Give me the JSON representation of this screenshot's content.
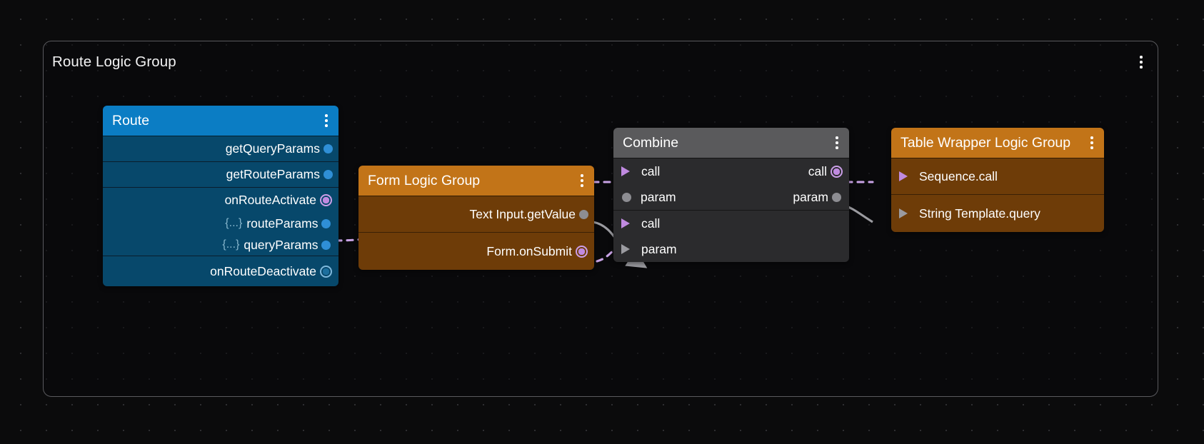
{
  "canvas": {
    "background_color": "#0b0b0c",
    "dot_grid_color": "#2e2e31"
  },
  "group_frame": {
    "title": "Route Logic Group",
    "menu_icon": "kebab-menu-icon",
    "border_color": "#5a5a5e"
  },
  "nodes": [
    {
      "id": "route",
      "title": "Route",
      "palette": "blue",
      "header_color": "#0b7dc4",
      "body_color": "#07486b",
      "menu_icon": "kebab-menu-icon",
      "sections": [
        {
          "rows": [
            {
              "label": "getQueryParams",
              "port": "dot-blue",
              "align": "right"
            }
          ]
        },
        {
          "rows": [
            {
              "label": "getRouteParams",
              "port": "dot-blue",
              "align": "right"
            }
          ]
        },
        {
          "rows": [
            {
              "label": "onRouteActivate",
              "port": "ring-purple",
              "align": "right"
            },
            {
              "prefix": "{...}",
              "label": "routeParams",
              "port": "dot-blue",
              "align": "right"
            },
            {
              "prefix": "{...}",
              "label": "queryParams",
              "port": "dot-blue",
              "align": "right"
            }
          ]
        },
        {
          "rows": [
            {
              "label": "onRouteDeactivate",
              "port": "ring-blue",
              "align": "right"
            }
          ]
        }
      ]
    },
    {
      "id": "form",
      "title": "Form Logic Group",
      "palette": "orange",
      "header_color": "#c27418",
      "body_color": "#6e3c08",
      "menu_icon": "kebab-menu-icon",
      "sections": [
        {
          "rows": [
            {
              "label": "Text Input.getValue",
              "port": "dot-gray",
              "align": "right"
            }
          ]
        },
        {
          "rows": [
            {
              "label": "Form.onSubmit",
              "port": "ring-purple",
              "align": "right"
            }
          ]
        }
      ]
    },
    {
      "id": "combine",
      "title": "Combine",
      "palette": "gray",
      "header_color": "#5a5a5c",
      "body_color": "#2b2b2d",
      "menu_icon": "kebab-menu-icon",
      "sections": [
        {
          "rows": [
            {
              "label": "call",
              "port": "tri-purple",
              "align": "left",
              "out_label": "call",
              "out_port": "ring-purple"
            },
            {
              "label": "param",
              "port": "dot-gray",
              "align": "left",
              "out_label": "param",
              "out_port": "dot-gray"
            }
          ]
        },
        {
          "rows": [
            {
              "label": "call",
              "port": "tri-purple",
              "align": "left"
            },
            {
              "label": "param",
              "port": "tri-gray",
              "align": "left"
            }
          ]
        }
      ]
    },
    {
      "id": "table",
      "title": "Table Wrapper Logic Group",
      "palette": "orange",
      "header_color": "#c27418",
      "body_color": "#6e3c08",
      "menu_icon": "kebab-menu-icon",
      "sections": [
        {
          "rows": [
            {
              "label": "Sequence.call",
              "port": "tri-purple",
              "align": "left"
            }
          ]
        },
        {
          "rows": [
            {
              "label": "String Template.query",
              "port": "tri-gray",
              "align": "left"
            }
          ]
        }
      ]
    }
  ],
  "edges": [
    {
      "from": "Route.onRouteActivate",
      "to": "Form Logic Group",
      "style": "dashed",
      "color": "#c9a3e6"
    },
    {
      "from": "Form Logic Group",
      "to": "Combine.call",
      "style": "dashed",
      "color": "#c9a3e6"
    },
    {
      "from": "Form.onSubmit",
      "to": "Combine.call",
      "style": "dashed",
      "color": "#c9a3e6"
    },
    {
      "from": "Text Input.getValue",
      "to": "Combine.param",
      "style": "solid",
      "color": "#9b9ba0"
    },
    {
      "from": "Combine.call",
      "to": "Sequence.call",
      "style": "dashed",
      "color": "#c9a3e6"
    },
    {
      "from": "Combine.param",
      "to": "String Template.query",
      "style": "solid",
      "color": "#9b9ba0"
    }
  ]
}
